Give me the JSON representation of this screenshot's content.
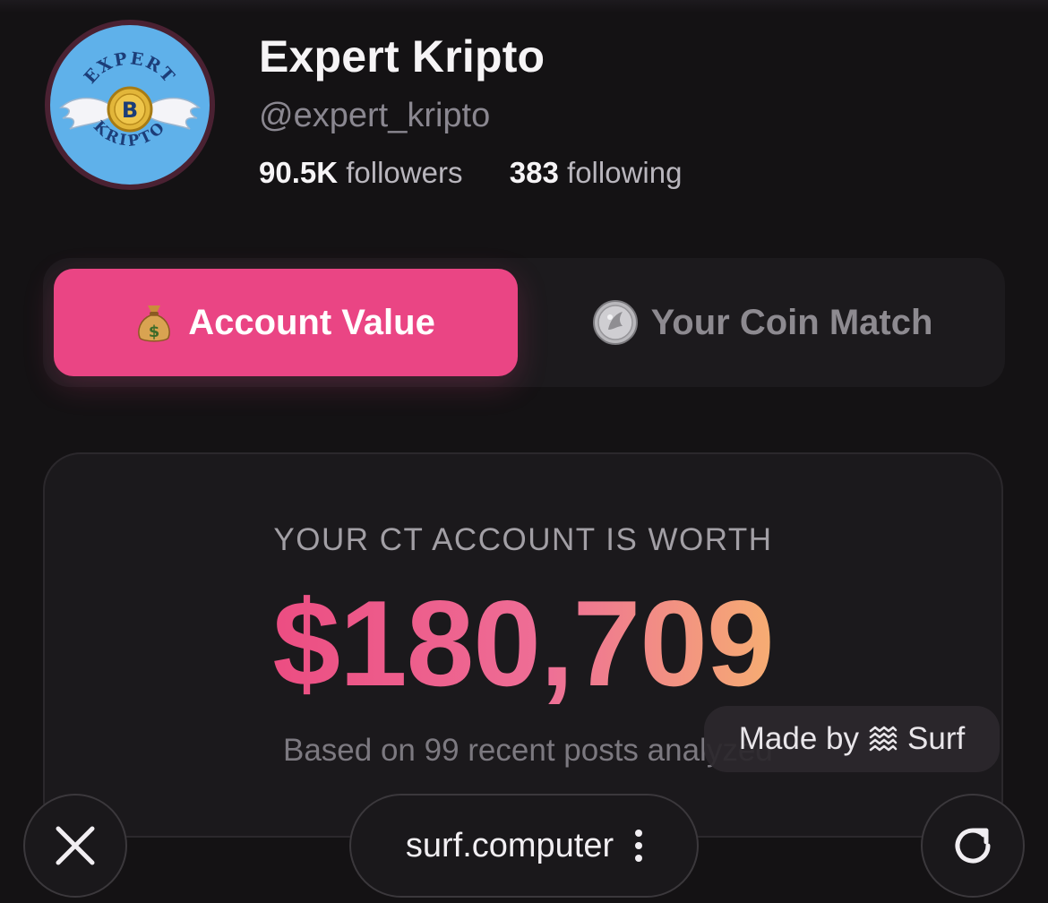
{
  "profile": {
    "name": "Expert Kripto",
    "handle": "@expert_kripto",
    "followers_count": "90.5K",
    "followers_label": "followers",
    "following_count": "383",
    "following_label": "following",
    "avatar_text_top": "EXPERT",
    "avatar_text_bottom": "KRIPTO",
    "avatar_coin_letter": "B",
    "avatar_icon": "winged-bitcoin-logo"
  },
  "tabs": [
    {
      "label": "Account Value",
      "icon": "money-bag-icon",
      "active": true
    },
    {
      "label": "Your Coin Match",
      "icon": "coin-icon",
      "active": false
    }
  ],
  "card": {
    "label": "YOUR CT ACCOUNT IS WORTH",
    "value": "$180,709",
    "subtitle": "Based on 99 recent posts analyzed"
  },
  "badge": {
    "prefix": "Made by",
    "brand": "Surf",
    "icon": "surf-logo-icon"
  },
  "browser": {
    "url": "surf.computer",
    "close_icon": "close-icon",
    "menu_icon": "kebab-menu-icon",
    "reload_icon": "reload-icon"
  },
  "colors": {
    "accent": "#ea4584",
    "background": "#141214",
    "value_gradient_start": "#ec4d82",
    "value_gradient_end": "#f6ad72",
    "avatar_bg": "#5fb1ea"
  }
}
